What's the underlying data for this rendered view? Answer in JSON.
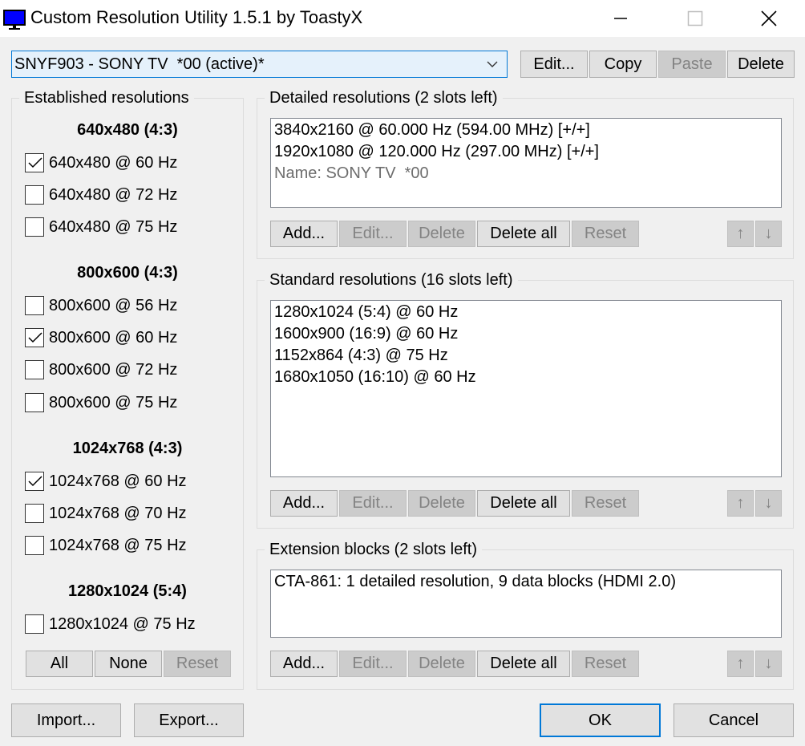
{
  "window": {
    "title": "Custom Resolution Utility 1.5.1 by ToastyX",
    "minimize_symbol": "—",
    "close_symbol": "✕"
  },
  "monitor": {
    "selected": "SNYF903 - SONY TV  *00 (active)*"
  },
  "top_buttons": {
    "edit": "Edit...",
    "copy": "Copy",
    "paste": "Paste",
    "delete": "Delete"
  },
  "established": {
    "title": "Established resolutions",
    "groups": [
      {
        "heading": "640x480 (4:3)",
        "items": [
          {
            "label": "640x480 @ 60 Hz",
            "checked": true
          },
          {
            "label": "640x480 @ 72 Hz",
            "checked": false
          },
          {
            "label": "640x480 @ 75 Hz",
            "checked": false
          }
        ]
      },
      {
        "heading": "800x600 (4:3)",
        "items": [
          {
            "label": "800x600 @ 56 Hz",
            "checked": false
          },
          {
            "label": "800x600 @ 60 Hz",
            "checked": true
          },
          {
            "label": "800x600 @ 72 Hz",
            "checked": false
          },
          {
            "label": "800x600 @ 75 Hz",
            "checked": false
          }
        ]
      },
      {
        "heading": "1024x768 (4:3)",
        "items": [
          {
            "label": "1024x768 @ 60 Hz",
            "checked": true
          },
          {
            "label": "1024x768 @ 70 Hz",
            "checked": false
          },
          {
            "label": "1024x768 @ 75 Hz",
            "checked": false
          }
        ]
      },
      {
        "heading": "1280x1024 (5:4)",
        "items": [
          {
            "label": "1280x1024 @ 75 Hz",
            "checked": false
          }
        ]
      }
    ],
    "buttons": {
      "all": "All",
      "none": "None",
      "reset": "Reset"
    }
  },
  "detailed": {
    "title": "Detailed resolutions (2 slots left)",
    "items": [
      "3840x2160 @ 60.000 Hz (594.00 MHz) [+/+]",
      "1920x1080 @ 120.000 Hz (297.00 MHz) [+/+]"
    ],
    "name_line": "Name: SONY TV  *00"
  },
  "standard": {
    "title": "Standard resolutions (16 slots left)",
    "items": [
      "1280x1024 (5:4) @ 60 Hz",
      "1600x900 (16:9) @ 60 Hz",
      "1152x864 (4:3) @ 75 Hz",
      "1680x1050 (16:10) @ 60 Hz"
    ]
  },
  "extension": {
    "title": "Extension blocks (2 slots left)",
    "items": [
      "CTA-861: 1 detailed resolution, 9 data blocks (HDMI 2.0)"
    ]
  },
  "list_buttons": {
    "add": "Add...",
    "edit": "Edit...",
    "delete": "Delete",
    "delete_all": "Delete all",
    "reset": "Reset",
    "up": "↑",
    "down": "↓"
  },
  "bottom_buttons": {
    "import": "Import...",
    "export": "Export...",
    "ok": "OK",
    "cancel": "Cancel"
  },
  "colors": {
    "accent": "#0078d7",
    "disabled_bg": "#cccccc",
    "disabled_text": "#838383",
    "icon_blue": "#0000ff"
  }
}
